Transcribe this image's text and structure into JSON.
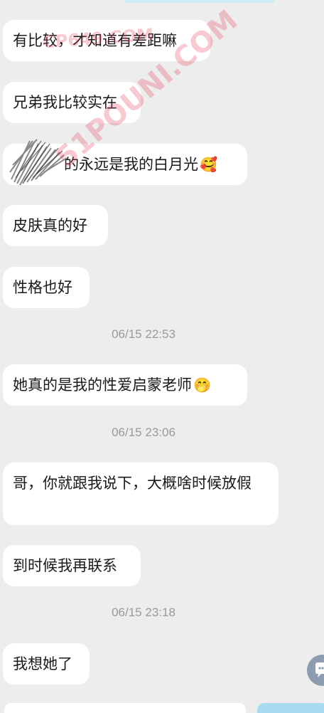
{
  "messages": [
    {
      "text": "有比较，才知道有差距嘛"
    },
    {
      "text": "兄弟我比较实在"
    },
    {
      "text": "的永远是我的白月光",
      "emoji": "🥰"
    },
    {
      "text": "皮肤真的好"
    },
    {
      "text": "性格也好"
    },
    {
      "text": "她真的是我的性爱启蒙老师",
      "emoji": "🤭"
    },
    {
      "text": "哥，你就跟我说下，大概啥时候放假"
    },
    {
      "text": "到时候我再联系"
    },
    {
      "text": "我想她了"
    }
  ],
  "timestamps": [
    "06/15 22:53",
    "06/15 23:06",
    "06/15 23:18"
  ],
  "watermarks": [
    "CP649.COM",
    "51POUNI.COM"
  ],
  "icons": {
    "redaction": "scribble-redaction-icon",
    "float": "chat-bubble-icon"
  },
  "colors": {
    "background": "#ededed",
    "bubble": "#ffffff",
    "timestamp": "#9a9a9a",
    "watermark": "#e63c5a"
  }
}
